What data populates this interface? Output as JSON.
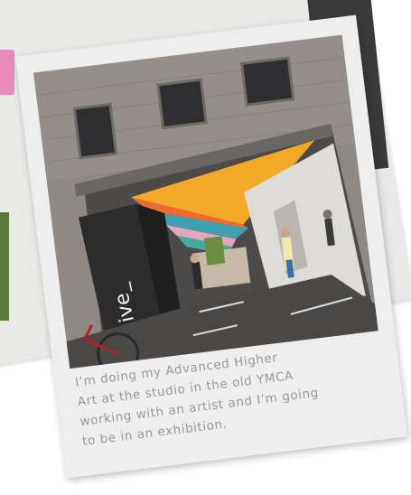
{
  "photo": {
    "signage": "hive_",
    "ceiling_colors": [
      "#f2a928",
      "#ee6b2d",
      "#3ea0b0",
      "#e7a6bd",
      "#f2b64c"
    ]
  },
  "caption": {
    "lines": [
      "I’m doing my Advanced Higher",
      "Art at the studio in the old YMCA",
      "working with an artist and I’m going",
      "to be in an exhibition."
    ]
  }
}
